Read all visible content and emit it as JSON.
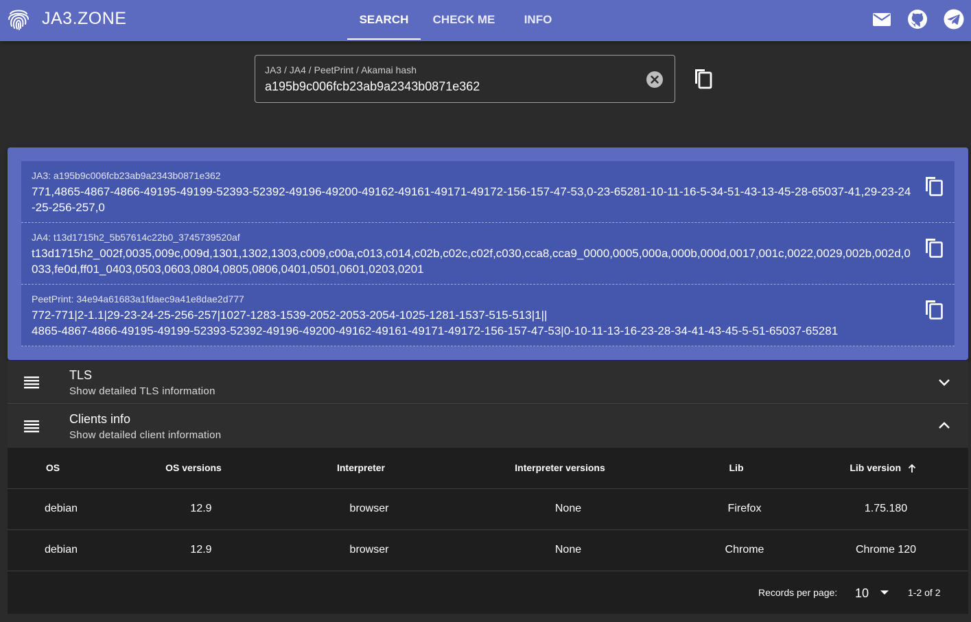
{
  "app": {
    "title": "JA3.ZONE"
  },
  "nav": {
    "tabs": [
      {
        "label": "SEARCH"
      },
      {
        "label": "CHECK ME"
      },
      {
        "label": "INFO"
      }
    ]
  },
  "header_icons": [
    "mail-icon",
    "github-icon",
    "telegram-icon"
  ],
  "search": {
    "label": "JA3 / JA4 / PeetPrint / Akamai hash",
    "value": "a195b9c006fcb23ab9a2343b0871e362"
  },
  "fingerprints": [
    {
      "label": "JA3: a195b9c006fcb23ab9a2343b0871e362",
      "value": "771,4865-4867-4866-49195-49199-52393-52392-49196-49200-49162-49161-49171-49172-156-157-47-53,0-23-65281-10-11-16-5-34-51-43-13-45-28-65037-41,29-23-24-25-256-257,0"
    },
    {
      "label": "JA4: t13d1715h2_5b57614c22b0_3745739520af",
      "value": "t13d1715h2_002f,0035,009c,009d,1301,1302,1303,c009,c00a,c013,c014,c02b,c02c,c02f,c030,cca8,cca9_0000,0005,000a,000b,000d,0017,001c,0022,0029,002b,002d,0033,fe0d,ff01_0403,0503,0603,0804,0805,0806,0401,0501,0601,0203,0201"
    },
    {
      "label": "PeetPrint: 34e94a61683a1fdaec9a41e8dae2d777",
      "value": "772-771|2-1.1|29-23-24-25-256-257|1027-1283-1539-2052-2053-2054-1025-1281-1537-515-513|1||\n4865-4867-4866-49195-49199-52393-52392-49196-49200-49162-49161-49171-49172-156-157-47-53|0-10-11-13-16-23-28-34-41-43-45-5-51-65037-65281"
    }
  ],
  "panels": {
    "tls": {
      "title": "TLS",
      "subtitle": "Show detailed TLS information"
    },
    "clients": {
      "title": "Clients info",
      "subtitle": "Show detailed client information"
    }
  },
  "table": {
    "headers": [
      "OS",
      "OS versions",
      "Interpreter",
      "Interpreter versions",
      "Lib",
      "Lib version"
    ],
    "rows": [
      [
        "debian",
        "12.9",
        "browser",
        "None",
        "Firefox",
        "1.75.180"
      ],
      [
        "debian",
        "12.9",
        "browser",
        "None",
        "Chrome",
        "Chrome 120"
      ]
    ],
    "footer": {
      "records_label": "Records per page:",
      "records_value": "10",
      "page_info": "1-2 of 2"
    }
  },
  "colors": {
    "primary": "#5c6bc0",
    "primary_dark": "#4556ad",
    "background": "#2b2b2b",
    "table_bg": "#1e1e1e"
  }
}
